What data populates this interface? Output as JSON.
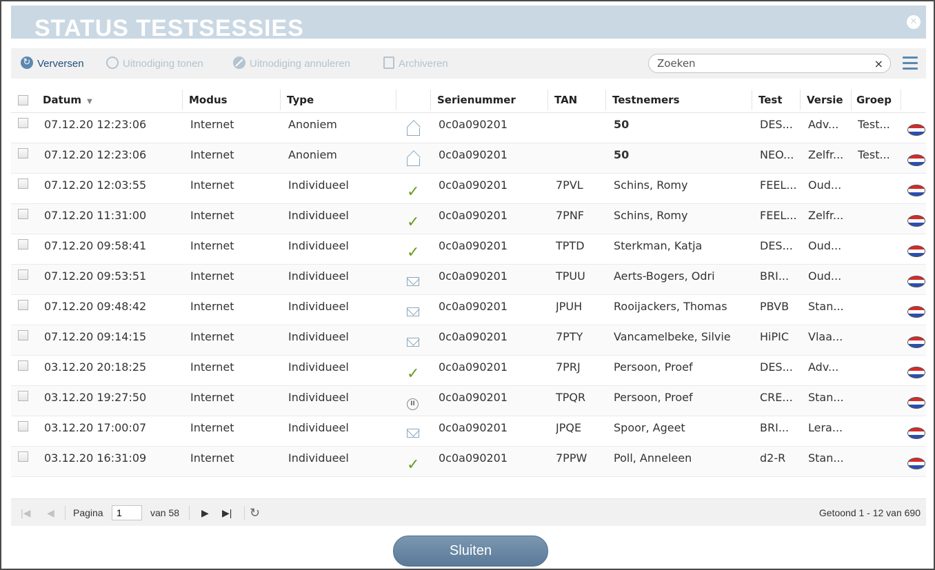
{
  "window": {
    "title": "STATUS TESTSESSIES",
    "close_icon": "close-icon"
  },
  "toolbar": {
    "refresh_label": "Verversen",
    "show_invite_label": "Uitnodiging tonen",
    "cancel_invite_label": "Uitnodiging annuleren",
    "archive_label": "Archiveren",
    "search_placeholder": "Zoeken",
    "search_clear": "×"
  },
  "columns": {
    "datum": "Datum",
    "modus": "Modus",
    "type": "Type",
    "serienummer": "Serienummer",
    "tan": "TAN",
    "testnemers": "Testnemers",
    "test": "Test",
    "versie": "Versie",
    "groep": "Groep"
  },
  "rows": [
    {
      "datum": "07.12.20 12:23:06",
      "modus": "Internet",
      "type": "Anoniem",
      "status": "envelope-open",
      "serie": "0c0a090201",
      "tan": "",
      "testnemers": "50",
      "test": "DES...",
      "versie": "Adv...",
      "groep": "Test..."
    },
    {
      "datum": "07.12.20 12:23:06",
      "modus": "Internet",
      "type": "Anoniem",
      "status": "envelope-open",
      "serie": "0c0a090201",
      "tan": "",
      "testnemers": "50",
      "test": "NEO...",
      "versie": "Zelfr...",
      "groep": "Test..."
    },
    {
      "datum": "07.12.20 12:03:55",
      "modus": "Internet",
      "type": "Individueel",
      "status": "check",
      "serie": "0c0a090201",
      "tan": "7PVL",
      "testnemers": "Schins, Romy",
      "test": "FEEL...",
      "versie": "Oud...",
      "groep": ""
    },
    {
      "datum": "07.12.20 11:31:00",
      "modus": "Internet",
      "type": "Individueel",
      "status": "check",
      "serie": "0c0a090201",
      "tan": "7PNF",
      "testnemers": "Schins, Romy",
      "test": "FEEL...",
      "versie": "Zelfr...",
      "groep": ""
    },
    {
      "datum": "07.12.20 09:58:41",
      "modus": "Internet",
      "type": "Individueel",
      "status": "check",
      "serie": "0c0a090201",
      "tan": "TPTD",
      "testnemers": "Sterkman, Katja",
      "test": "DES...",
      "versie": "Oud...",
      "groep": ""
    },
    {
      "datum": "07.12.20 09:53:51",
      "modus": "Internet",
      "type": "Individueel",
      "status": "envelope",
      "serie": "0c0a090201",
      "tan": "TPUU",
      "testnemers": "Aerts-Bogers, Odri",
      "test": "BRI...",
      "versie": "Oud...",
      "groep": ""
    },
    {
      "datum": "07.12.20 09:48:42",
      "modus": "Internet",
      "type": "Individueel",
      "status": "envelope",
      "serie": "0c0a090201",
      "tan": "JPUH",
      "testnemers": "Rooijackers, Thomas",
      "test": "PBVB",
      "versie": "Stan...",
      "groep": ""
    },
    {
      "datum": "07.12.20 09:14:15",
      "modus": "Internet",
      "type": "Individueel",
      "status": "envelope",
      "serie": "0c0a090201",
      "tan": "7PTY",
      "testnemers": "Vancamelbeke, Silvie",
      "test": "HiPIC",
      "versie": "Vlaa...",
      "groep": ""
    },
    {
      "datum": "03.12.20 20:18:25",
      "modus": "Internet",
      "type": "Individueel",
      "status": "check",
      "serie": "0c0a090201",
      "tan": "7PRJ",
      "testnemers": "Persoon, Proef",
      "test": "DES...",
      "versie": "Adv...",
      "groep": ""
    },
    {
      "datum": "03.12.20 19:27:50",
      "modus": "Internet",
      "type": "Individueel",
      "status": "pause",
      "serie": "0c0a090201",
      "tan": "TPQR",
      "testnemers": "Persoon, Proef",
      "test": "CRE...",
      "versie": "Stan...",
      "groep": ""
    },
    {
      "datum": "03.12.20 17:00:07",
      "modus": "Internet",
      "type": "Individueel",
      "status": "envelope",
      "serie": "0c0a090201",
      "tan": "JPQE",
      "testnemers": "Spoor, Ageet",
      "test": "BRI...",
      "versie": "Lera...",
      "groep": ""
    },
    {
      "datum": "03.12.20 16:31:09",
      "modus": "Internet",
      "type": "Individueel",
      "status": "check",
      "serie": "0c0a090201",
      "tan": "7PPW",
      "testnemers": "Poll, Anneleen",
      "test": "d2-R",
      "versie": "Stan...",
      "groep": ""
    }
  ],
  "pager": {
    "page_label": "Pagina",
    "page_value": "1",
    "of_label": "van 58",
    "info": "Getoond 1 - 12 van 690"
  },
  "footer": {
    "close_label": "Sluiten"
  },
  "colors": {
    "accent": "#5b88b0",
    "title_bar": "#c9d8e3",
    "check": "#6a9a1d"
  }
}
